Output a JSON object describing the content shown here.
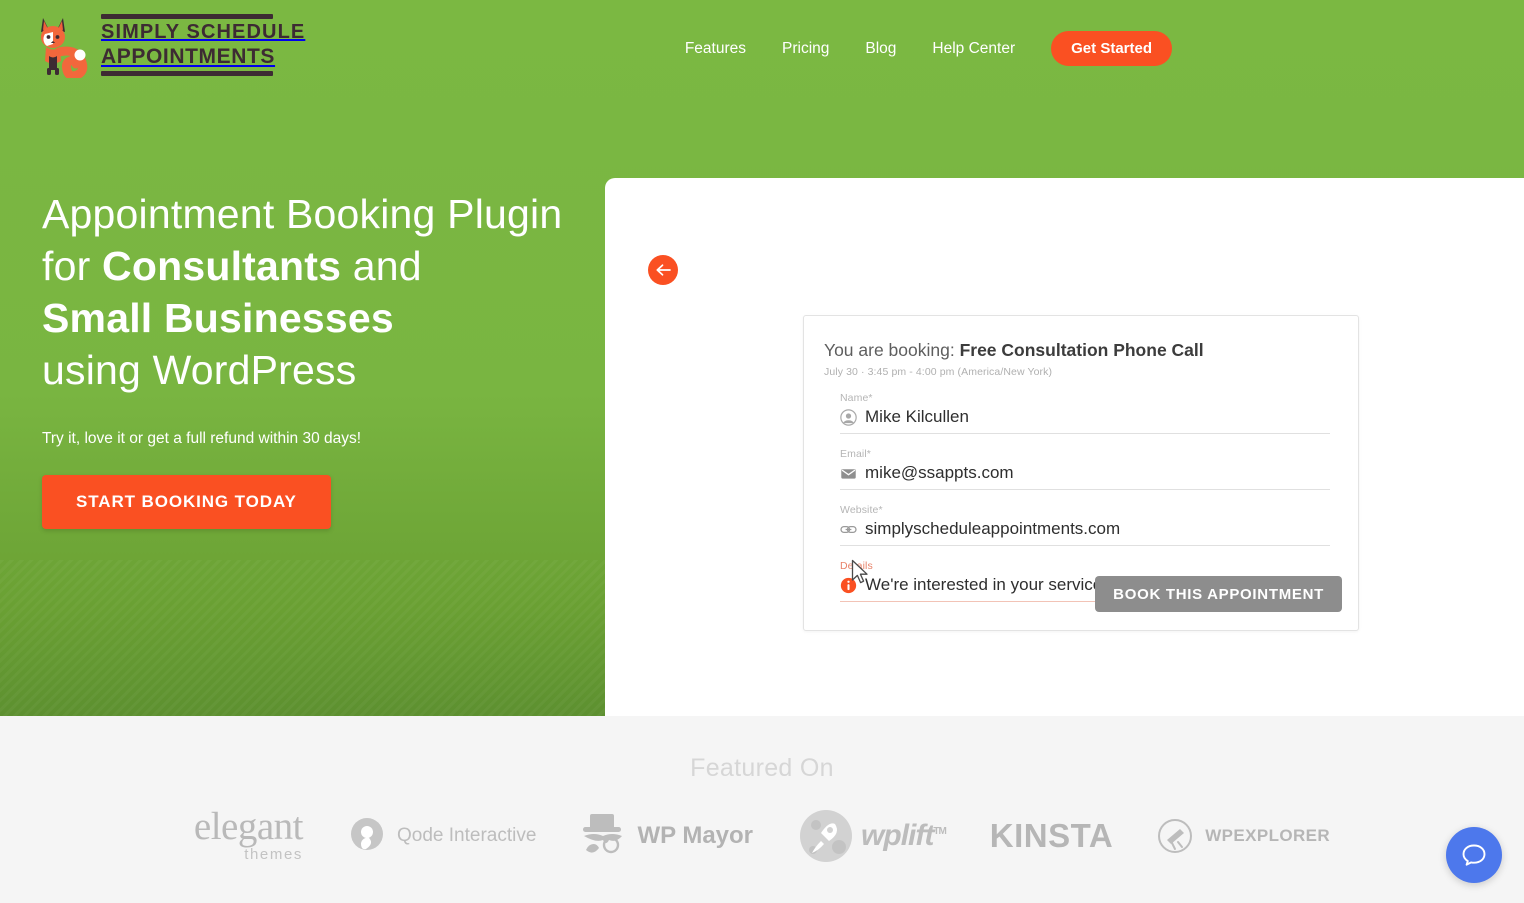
{
  "brand": {
    "logo_line1": "SIMPLY SCHEDULE",
    "logo_line2": "APPOINTMENTS",
    "fox_icon": "fox-logo-icon",
    "green": "#7bb842",
    "orange": "#fa5022",
    "dark": "#3d2b33"
  },
  "nav": {
    "items": [
      {
        "label": "Features"
      },
      {
        "label": "Pricing"
      },
      {
        "label": "Blog"
      },
      {
        "label": "Help Center"
      }
    ],
    "cta_label": "Get Started"
  },
  "hero": {
    "headline_line1": "Appointment Booking Plugin",
    "headline_line2_pre": "for ",
    "headline_line2_bold": "Consultants",
    "headline_line2_post": " and",
    "headline_line3_bold": "Small Businesses",
    "headline_line4": "using WordPress",
    "subcopy": "Try it, love it or get a full refund within 30 days!",
    "cta_label": "START BOOKING TODAY"
  },
  "panel": {
    "back_button_icon": "arrow-left-icon"
  },
  "booking_card": {
    "title_prefix": "You are booking: ",
    "title_service": "Free Consultation Phone Call",
    "date_line": "July 30  ·  3:45 pm - 4:00 pm (America/New York)",
    "fields": [
      {
        "label": "Name*",
        "value": "Mike Kilcullen",
        "icon": "person-avatar-icon",
        "error": false
      },
      {
        "label": "Email*",
        "value": "mike@ssappts.com",
        "icon": "envelope-icon",
        "error": false
      },
      {
        "label": "Website*",
        "value": "simplyscheduleappointments.com",
        "icon": "link-icon",
        "error": false
      },
      {
        "label": "Details",
        "value": "We're interested in your services!",
        "icon": "info-circle-icon",
        "error": true
      }
    ],
    "submit_label": "BOOK THIS APPOINTMENT"
  },
  "featured": {
    "title": "Featured On",
    "logos": [
      {
        "name": "elegant-themes",
        "word1": "elegant",
        "word2": "themes"
      },
      {
        "name": "qode-interactive",
        "text": "Qode Interactive"
      },
      {
        "name": "wp-mayor",
        "text": "WP Mayor"
      },
      {
        "name": "wplift",
        "text": "wplift",
        "sup": "TM"
      },
      {
        "name": "kinsta",
        "text": "KINSTA"
      },
      {
        "name": "wpexplorer",
        "text": "WPEXPLORER"
      }
    ]
  },
  "chat": {
    "icon": "chat-bubble-icon",
    "color": "#4d78ec"
  }
}
